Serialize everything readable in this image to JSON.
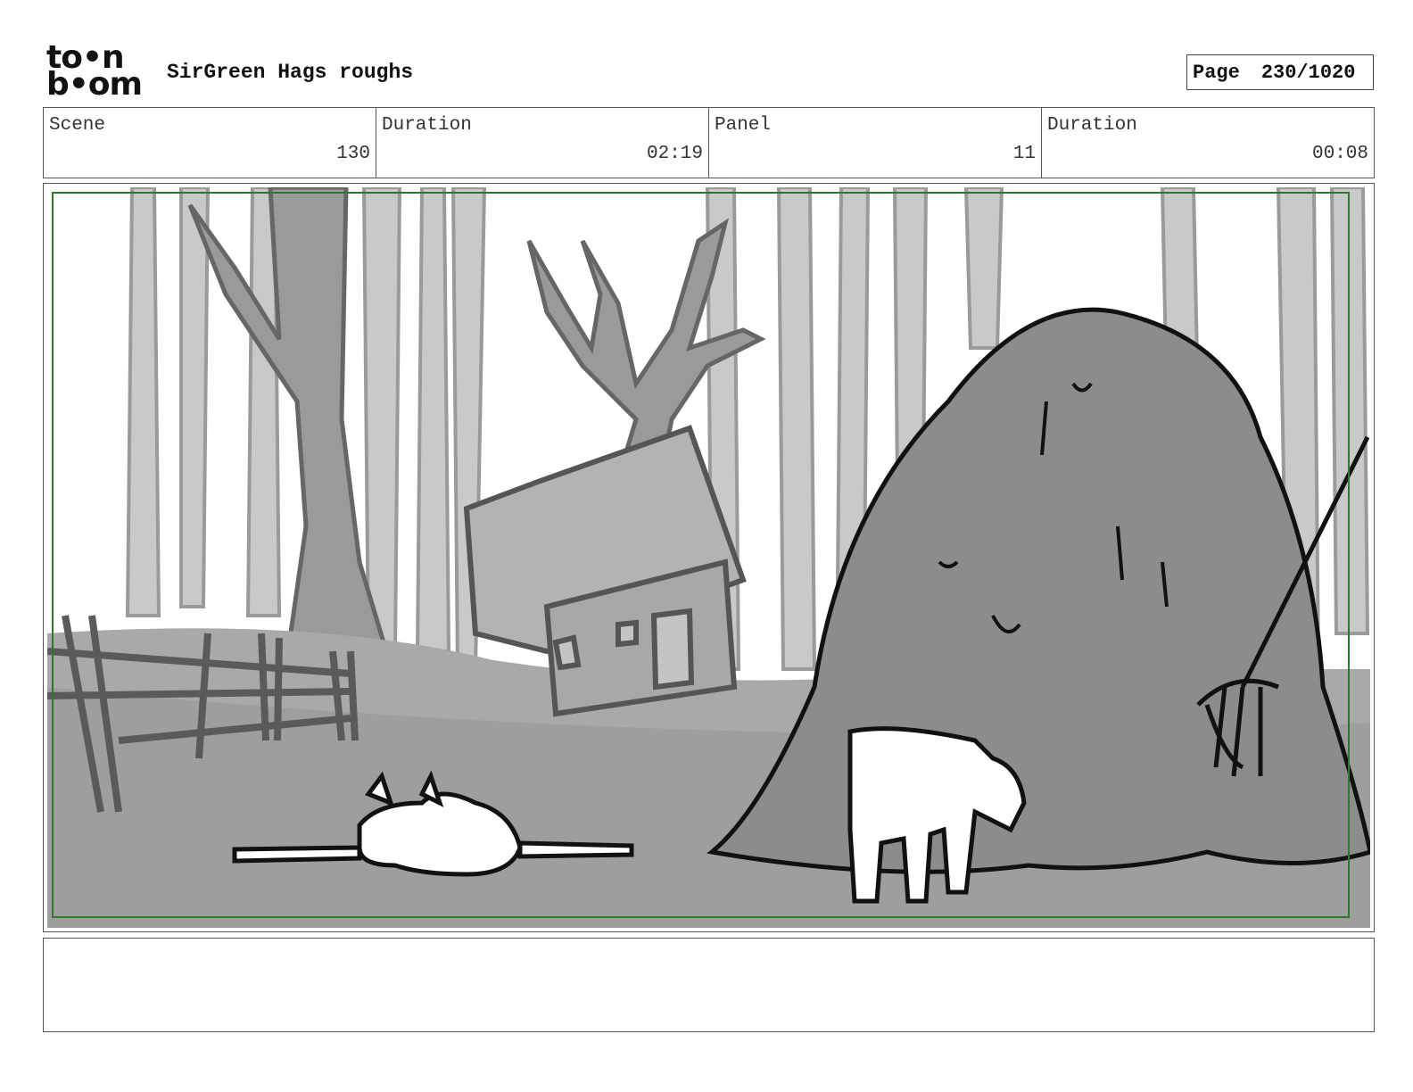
{
  "header": {
    "logo_top": "to•n",
    "logo_bottom": "b•om",
    "project_title": "SirGreen Hags roughs",
    "page_label": "Page",
    "page_value": "230/1020"
  },
  "info": {
    "scene_label": "Scene",
    "scene_value": "130",
    "duration_label": "Duration",
    "duration_value": "02:19",
    "panel_label": "Panel",
    "panel_value": "11",
    "panel_duration_label": "Duration",
    "panel_duration_value": "00:08"
  },
  "panel_image": {
    "icon": "storyboard-sketch",
    "frame_color": "#2a7a2a"
  },
  "notes": {
    "text": ""
  }
}
